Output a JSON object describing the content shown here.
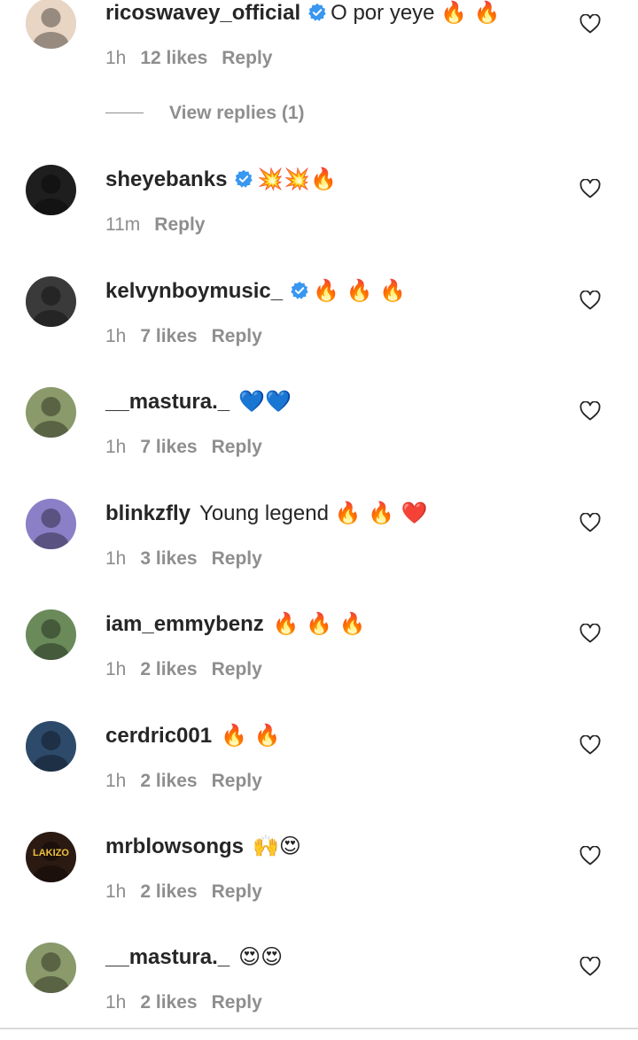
{
  "comments": [
    {
      "username": "ricoswavey_official",
      "verified": true,
      "text": "O por yeye",
      "emojis": "🔥 🔥",
      "time": "1h",
      "likes": "12 likes",
      "reply": "Reply",
      "avatar_color": "#e8d5c4"
    },
    {
      "username": "sheyebanks",
      "verified": true,
      "text": "",
      "emojis": "💥💥🔥",
      "time": "11m",
      "likes": "",
      "reply": "Reply",
      "avatar_color": "#1e1e1e"
    },
    {
      "username": "kelvynboymusic_",
      "verified": true,
      "text": "",
      "emojis": "🔥 🔥 🔥",
      "time": "1h",
      "likes": "7 likes",
      "reply": "Reply",
      "avatar_color": "#3a3a3a"
    },
    {
      "username": "__mastura._",
      "verified": false,
      "text": "",
      "emojis": "💙💙",
      "time": "1h",
      "likes": "7 likes",
      "reply": "Reply",
      "avatar_color": "#8a9a6a"
    },
    {
      "username": "blinkzfly",
      "verified": false,
      "text": "Young legend",
      "emojis": "🔥 🔥 ❤️",
      "time": "1h",
      "likes": "3 likes",
      "reply": "Reply",
      "avatar_color": "#8b7fc7"
    },
    {
      "username": "iam_emmybenz",
      "verified": false,
      "text": "",
      "emojis": "🔥 🔥 🔥",
      "time": "1h",
      "likes": "2 likes",
      "reply": "Reply",
      "avatar_color": "#6a8a5a"
    },
    {
      "username": "cerdric001",
      "verified": false,
      "text": "",
      "emojis": "🔥 🔥",
      "time": "1h",
      "likes": "2 likes",
      "reply": "Reply",
      "avatar_color": "#2d4a6a"
    },
    {
      "username": "mrblowsongs",
      "verified": false,
      "text": "",
      "emojis": "🙌😍",
      "time": "1h",
      "likes": "2 likes",
      "reply": "Reply",
      "avatar_color": "#2a1a12"
    },
    {
      "username": "__mastura._",
      "verified": false,
      "text": "",
      "emojis": "😍😍",
      "time": "1h",
      "likes": "2 likes",
      "reply": "Reply",
      "avatar_color": "#8a9a6a"
    }
  ],
  "view_replies": "View replies (1)",
  "avatar_label": "LAKIZO",
  "colors": {
    "verified": "#3897f0",
    "meta": "#8e8e8e",
    "text": "#262626"
  }
}
